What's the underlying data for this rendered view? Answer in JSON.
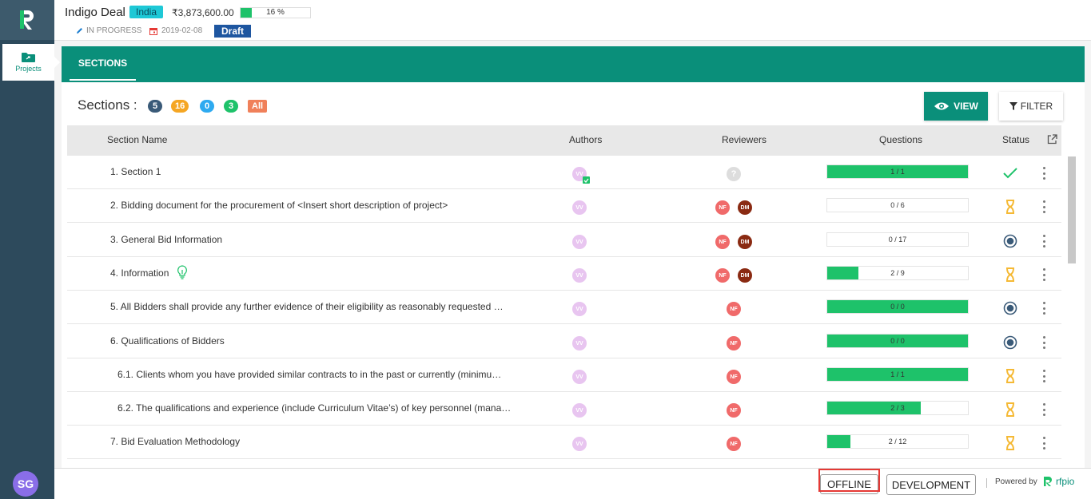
{
  "sidebar": {
    "nav_projects": "Projects",
    "user_initials": "SG"
  },
  "header": {
    "deal_title": "Indigo Deal",
    "country": "India",
    "amount": "₹3,873,600.00",
    "progress_percent": 16,
    "progress_text": "16 %",
    "status": "IN PROGRESS",
    "date": "2019-02-08",
    "draft_label": "Draft"
  },
  "tabs": {
    "sections": "SECTIONS"
  },
  "toolbar": {
    "sections_label": "Sections :",
    "counts": [
      "5",
      "16",
      "0",
      "3",
      "All"
    ],
    "view_label": "VIEW",
    "filter_label": "FILTER"
  },
  "table": {
    "headers": {
      "section_name": "Section Name",
      "authors": "Authors",
      "reviewers": "Reviewers",
      "questions": "Questions",
      "status": "Status"
    },
    "rows": [
      {
        "name": "1.  Section 1",
        "author": "VV",
        "reviewers": [
          "?"
        ],
        "q_done": 1,
        "q_total": 1,
        "questions": "1 / 1",
        "status": "done",
        "author_checked": true
      },
      {
        "name": "2.  Bidding document for the procurement of <Insert short description of project>",
        "author": "VV",
        "reviewers": [
          "NF",
          "DM"
        ],
        "q_done": 0,
        "q_total": 6,
        "questions": "0 / 6",
        "status": "pending"
      },
      {
        "name": "3.  General Bid Information",
        "author": "VV",
        "reviewers": [
          "NF",
          "DM"
        ],
        "q_done": 0,
        "q_total": 17,
        "questions": "0 / 17",
        "status": "review"
      },
      {
        "name": "4.  Information",
        "author": "VV",
        "reviewers": [
          "NF",
          "DM"
        ],
        "q_done": 2,
        "q_total": 9,
        "questions": "2 / 9",
        "status": "pending",
        "bulb": true
      },
      {
        "name": "5.  All Bidders shall provide any further evidence of their eligibility as reasonably requested …",
        "author": "VV",
        "reviewers": [
          "NF"
        ],
        "q_done": 0,
        "q_total": 0,
        "questions": "0 / 0",
        "status": "review",
        "full": true
      },
      {
        "name": "6.  Qualifications of Bidders",
        "author": "VV",
        "reviewers": [
          "NF"
        ],
        "q_done": 0,
        "q_total": 0,
        "questions": "0 / 0",
        "status": "review",
        "full": true
      },
      {
        "name": "6.1.  Clients whom you have provided similar contracts to in the past or currently (minimu…",
        "author": "VV",
        "reviewers": [
          "NF"
        ],
        "q_done": 1,
        "q_total": 1,
        "questions": "1 / 1",
        "status": "pending",
        "sub": true
      },
      {
        "name": "6.2.  The qualifications and experience (include Curriculum Vitae’s) of key personnel (mana…",
        "author": "VV",
        "reviewers": [
          "NF"
        ],
        "q_done": 2,
        "q_total": 3,
        "questions": "2 / 3",
        "status": "pending",
        "sub": true
      },
      {
        "name": "7.  Bid Evaluation Methodology",
        "author": "VV",
        "reviewers": [
          "NF"
        ],
        "q_done": 2,
        "q_total": 12,
        "questions": "2 / 12",
        "status": "pending"
      }
    ]
  },
  "footer": {
    "offline_label": "OFFLINE",
    "development_label": "DEVELOPMENT",
    "powered_by": "Powered by",
    "brand": "rfpio"
  },
  "colors": {
    "accent": "#0a8f7a",
    "progress": "#1ec26a",
    "sidebar": "#2d4a5c",
    "pending": "#f5b935",
    "review": "#3a5a78"
  }
}
